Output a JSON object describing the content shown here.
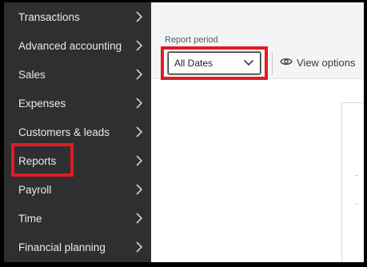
{
  "sidebar": {
    "items": [
      {
        "label": "Transactions"
      },
      {
        "label": "Advanced accounting"
      },
      {
        "label": "Sales"
      },
      {
        "label": "Expenses"
      },
      {
        "label": "Customers & leads"
      },
      {
        "label": "Reports"
      },
      {
        "label": "Payroll"
      },
      {
        "label": "Time"
      },
      {
        "label": "Financial planning"
      }
    ]
  },
  "filters": {
    "report_period_label": "Report period",
    "report_period_value": "All Dates",
    "view_options_label": "View options"
  },
  "colors": {
    "sidebar_bg": "#2e2f31",
    "highlight": "#e21b22"
  },
  "icons": {
    "nav_chevron": "chevron-right-icon",
    "select_chevron": "chevron-down-icon",
    "view_options": "eye-icon"
  }
}
